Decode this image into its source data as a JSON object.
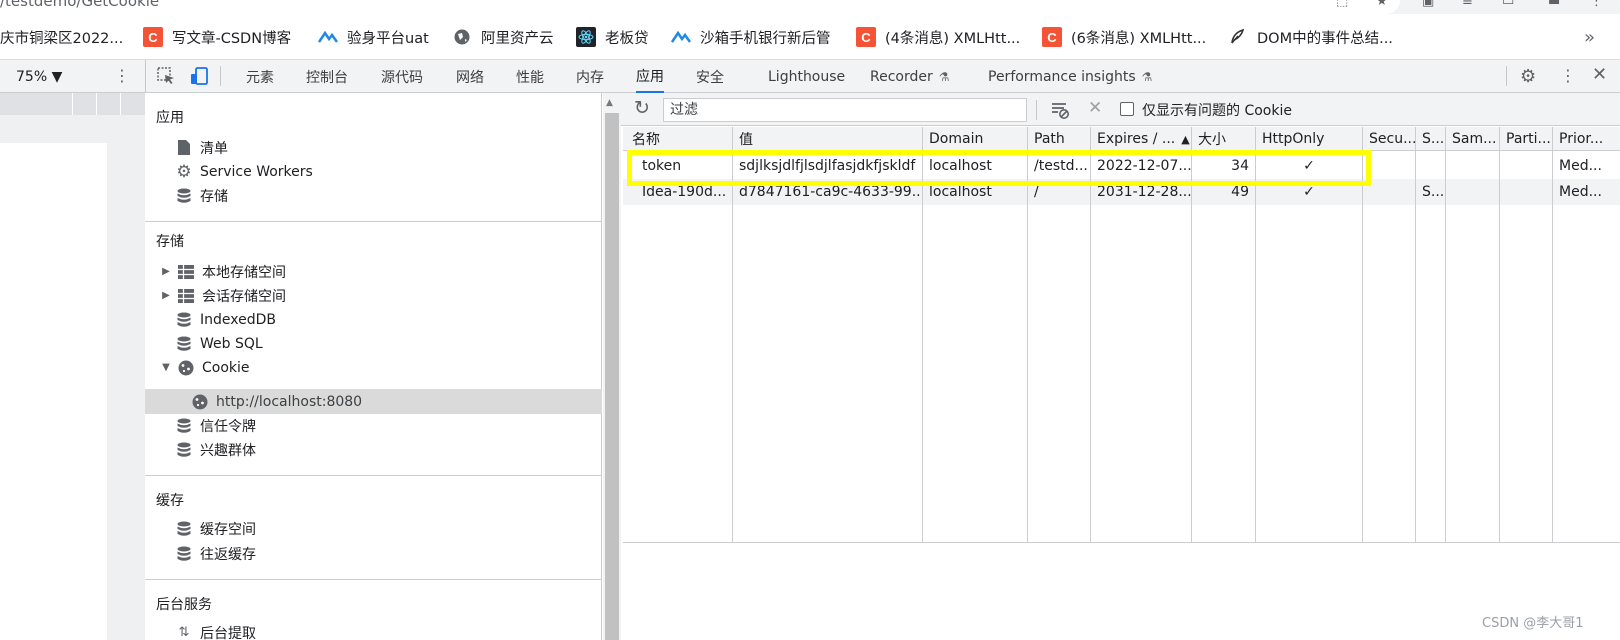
{
  "browser": {
    "url_fragment": "/testdemo/GetCookie",
    "bookmarks": [
      {
        "label": "庆市铜梁区2022...",
        "icon": "none"
      },
      {
        "label": "写文章-CSDN博客",
        "icon": "csdn-icon"
      },
      {
        "label": "验身平台uat",
        "icon": "wave-icon"
      },
      {
        "label": "阿里资产云",
        "icon": "globe-icon"
      },
      {
        "label": "老板贷",
        "icon": "react-icon"
      },
      {
        "label": "沙箱手机银行新后管",
        "icon": "wave-icon"
      },
      {
        "label": "(4条消息) XMLHtt...",
        "icon": "csdn-icon"
      },
      {
        "label": "(6条消息) XMLHtt...",
        "icon": "csdn-icon"
      },
      {
        "label": "DOM中的事件总结...",
        "icon": "feather-icon"
      }
    ],
    "more": "»"
  },
  "devtools": {
    "zoom": "75% ▼",
    "tabs": [
      "元素",
      "控制台",
      "源代码",
      "网络",
      "性能",
      "内存",
      "应用",
      "安全",
      "Lighthouse",
      "Recorder",
      "Performance insights"
    ],
    "active_tab": "应用"
  },
  "sidebar": {
    "sections": [
      {
        "title": "应用",
        "items": [
          "清单",
          "Service Workers",
          "存储"
        ]
      },
      {
        "title": "存储",
        "items": [
          "本地存储空间",
          "会话存储空间",
          "IndexedDB",
          "Web SQL",
          "Cookie",
          "http://localhost:8080",
          "信任令牌",
          "兴趣群体"
        ]
      },
      {
        "title": "缓存",
        "items": [
          "缓存空间",
          "往返缓存"
        ]
      },
      {
        "title": "后台服务",
        "items": [
          "后台提取"
        ]
      }
    ]
  },
  "cookies": {
    "filter_placeholder": "过滤",
    "only_issues_label": "仅显示有问题的 Cookie",
    "columns": [
      "名称",
      "值",
      "Domain",
      "Path",
      "Expires / ...",
      "大小",
      "HttpOnly",
      "Secu...",
      "S...",
      "Sam...",
      "Parti...",
      "Prior..."
    ],
    "rows": [
      {
        "name": "token",
        "value": "sdjlksjdlfjlsdjlfasjdkfjskldf",
        "domain": "localhost",
        "path": "/testd...",
        "expires": "2022-12-07...",
        "size": "34",
        "httponly": "✓",
        "secure": "",
        "samesite_s": "",
        "samesite": "",
        "partition": "",
        "priority": "Med..."
      },
      {
        "name": "Idea-190d...",
        "value": "d7847161-ca9c-4633-99...",
        "domain": "localhost",
        "path": "/",
        "expires": "2031-12-28...",
        "size": "49",
        "httponly": "✓",
        "secure": "",
        "samesite_s": "S...",
        "samesite": "",
        "partition": "",
        "priority": "Med..."
      }
    ]
  },
  "watermark": "CSDN @李大哥1",
  "colors": {
    "highlight": "#ffff00",
    "active_tab": "#1a73e8",
    "csdn": "#f55336"
  }
}
